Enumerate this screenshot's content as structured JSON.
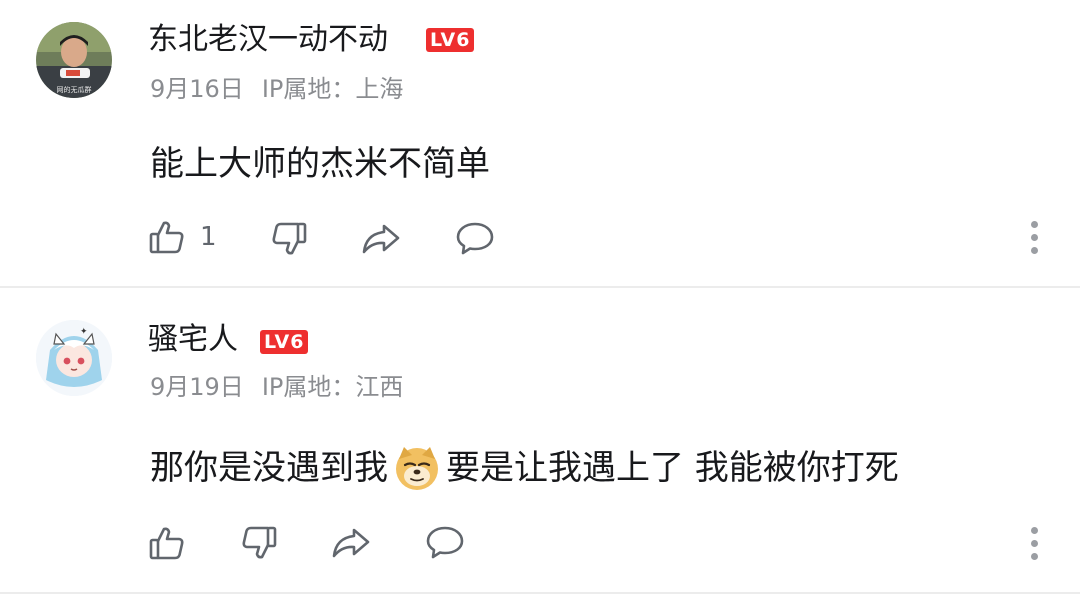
{
  "comments": [
    {
      "username": "东北老汉一动不动",
      "level": "LV6",
      "date": "9月16日",
      "ip": "IP属地：上海",
      "text": "能上大师的杰米不简单",
      "like_count": "1",
      "avatar_caption": "网的无瓜群"
    },
    {
      "username": "骚宅人",
      "level": "LV6",
      "date": "9月19日",
      "ip": "IP属地：江西",
      "text_before": "那你是没遇到我",
      "text_after": "要是让我遇上了 我能被你打死",
      "emoji": "doge-emoji",
      "like_count": ""
    }
  ],
  "icons": {
    "like": "thumbs-up-icon",
    "dislike": "thumbs-down-icon",
    "share": "share-icon",
    "reply": "comment-bubble-icon",
    "more": "more-vertical-icon"
  },
  "colors": {
    "level_badge": "#ee2f2f",
    "meta_text": "#8a8c90",
    "icon": "#61666d",
    "divider": "#ececec"
  }
}
